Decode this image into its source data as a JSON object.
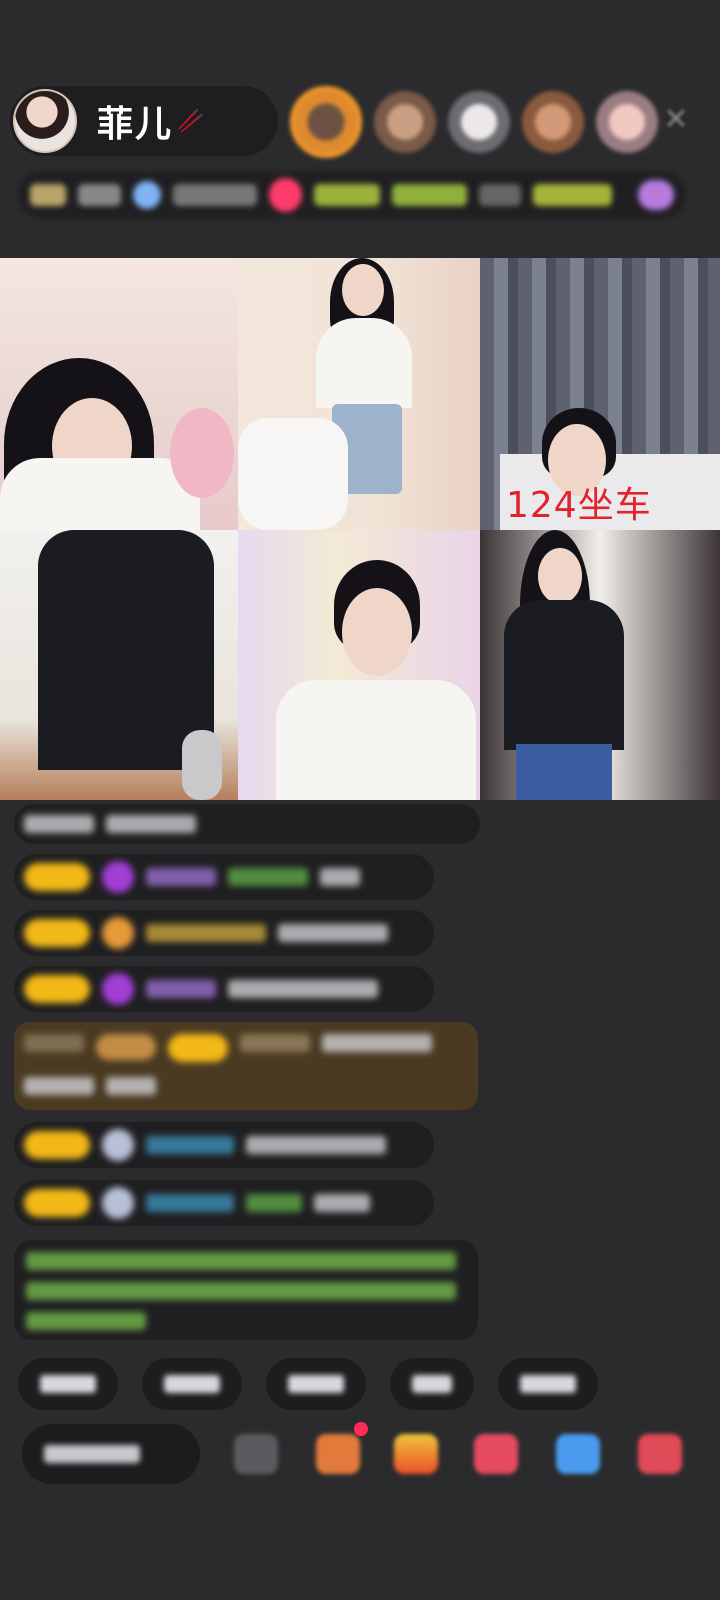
{
  "header": {
    "host_name": "菲儿",
    "host_emoji": "🥢"
  },
  "video_grid": {
    "tiles": [
      {
        "label": ""
      },
      {
        "label": ""
      },
      {
        "label": "124坐车"
      },
      {
        "label": ""
      },
      {
        "label": ""
      },
      {
        "label": ""
      }
    ]
  },
  "colors": {
    "background": "#2b2b2d",
    "pill": "#1f1f21",
    "level_badge": "#f2b817",
    "accent_red": "#e2232e"
  },
  "icons": [
    "close-icon",
    "fan-badge-icon",
    "gift-icon",
    "game-icon",
    "share-icon",
    "wallet-icon"
  ]
}
